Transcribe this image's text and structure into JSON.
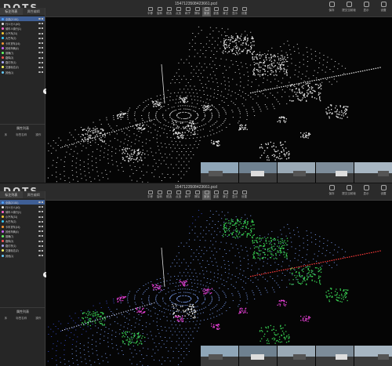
{
  "app": {
    "logo": "DOTS"
  },
  "panels": [
    {
      "filename": "1547123508423661.pcd",
      "tabs": [
        "标注列表",
        "属性编辑"
      ],
      "layers": [
        {
          "label": "全部(2/181)",
          "color": "#4fa3ff"
        },
        {
          "label": "行人行人(40)",
          "color": "#e6e6e6"
        },
        {
          "label": "骑车人骑行(1)",
          "color": "#ff66cc"
        },
        {
          "label": "小汽车(31)",
          "color": "#ffcc33"
        },
        {
          "label": "大巴车(2)",
          "color": "#33ccff"
        },
        {
          "label": "卡车货车(16)",
          "color": "#ff9933"
        },
        {
          "label": "其他车辆(4)",
          "color": "#cc66ff"
        },
        {
          "label": "锥桶(7)",
          "color": "#66ff66"
        },
        {
          "label": "路障(3)",
          "color": "#ff5555"
        },
        {
          "label": "路灯杆(1)",
          "color": "#aaaaff"
        },
        {
          "label": "交通标志(2)",
          "color": "#ffff66"
        },
        {
          "label": "其他(1)",
          "color": "#66ccff"
        }
      ],
      "section": {
        "title": "属性列表",
        "col1": "序",
        "col2": "标签名称",
        "col3": "操作"
      },
      "tools": [
        "平移",
        "旋转",
        "框选",
        "点选",
        "刷子",
        "擦除",
        "撤销",
        "重做",
        "清空",
        "显示",
        "设置"
      ],
      "right_actions": [
        "保存",
        "提交当前帧",
        "显示",
        "设置"
      ]
    },
    {
      "filename": "1547123508423661.pcd",
      "tabs": [
        "标注列表",
        "属性编辑"
      ],
      "layers": [
        {
          "label": "全部(2/181)",
          "color": "#4fa3ff"
        },
        {
          "label": "行人行人(40)",
          "color": "#e6e6e6"
        },
        {
          "label": "骑车人骑行(1)",
          "color": "#ff66cc"
        },
        {
          "label": "小汽车(31)",
          "color": "#ffcc33"
        },
        {
          "label": "大巴车(2)",
          "color": "#33ccff"
        },
        {
          "label": "卡车货车(16)",
          "color": "#ff9933"
        },
        {
          "label": "其他车辆(4)",
          "color": "#cc66ff"
        },
        {
          "label": "锥桶(7)",
          "color": "#66ff66"
        },
        {
          "label": "路障(3)",
          "color": "#ff5555"
        },
        {
          "label": "路灯杆(1)",
          "color": "#aaaaff"
        },
        {
          "label": "交通标志(2)",
          "color": "#ffff66"
        },
        {
          "label": "其他(1)",
          "color": "#66ccff"
        }
      ],
      "section": {
        "title": "属性列表",
        "col1": "序",
        "col2": "标签名称",
        "col3": "操作"
      },
      "tools": [
        "平移",
        "旋转",
        "框选",
        "点选",
        "刷子",
        "擦除",
        "撤销",
        "重做",
        "清空",
        "显示",
        "设置"
      ],
      "right_actions": [
        "保存",
        "提交当前帧",
        "显示",
        "设置"
      ]
    }
  ],
  "colors": {
    "bg": "#050505",
    "panel": "#262626",
    "selected": "#3f5f96",
    "points_white": "#e8e8e8",
    "points_green": "#39d353",
    "points_magenta": "#e03fd0",
    "points_blue": "#3a4fd8",
    "points_red": "#ff3b3b"
  }
}
